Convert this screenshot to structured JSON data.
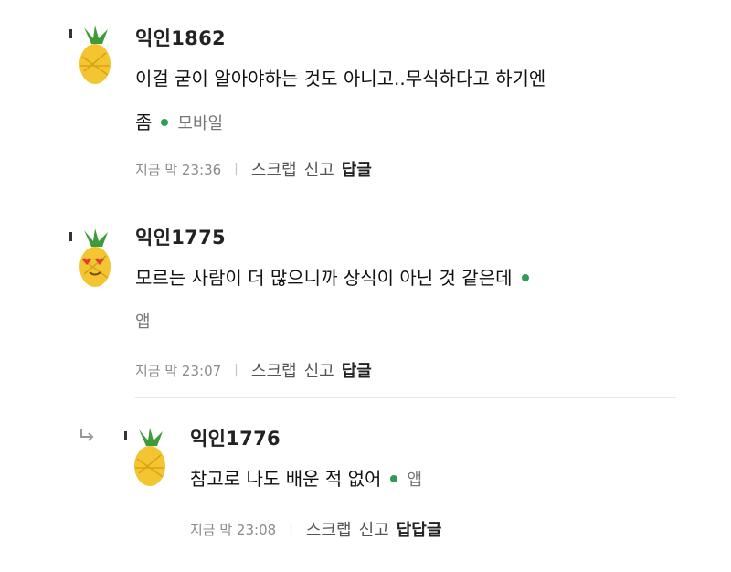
{
  "comments": [
    {
      "nickname": "익인1862",
      "text_line1": "이걸 굳이 알아야하는 것도 아니고..무식하다고 하기엔",
      "text_line2": "좀",
      "device": "모바일",
      "time": "지금 막 23:36",
      "scrap": "스크랩",
      "report": "신고",
      "reply": "답글"
    },
    {
      "nickname": "익인1775",
      "text_line1": "모르는 사람이 더 많으니까 상식이 아닌 것 같은데",
      "device": "앱",
      "time": "지금 막 23:07",
      "scrap": "스크랩",
      "report": "신고",
      "reply": "답글"
    },
    {
      "nickname": "익인1776",
      "text_line1": "참고로 나도 배운 적 없어",
      "device": "앱",
      "time": "지금 막 23:08",
      "scrap": "스크랩",
      "report": "신고",
      "reply": "답답글"
    }
  ],
  "colors": {
    "online_dot": "#2e9d52",
    "pineapple_body": "#f2c531",
    "pineapple_leaf": "#3f9a3a"
  }
}
